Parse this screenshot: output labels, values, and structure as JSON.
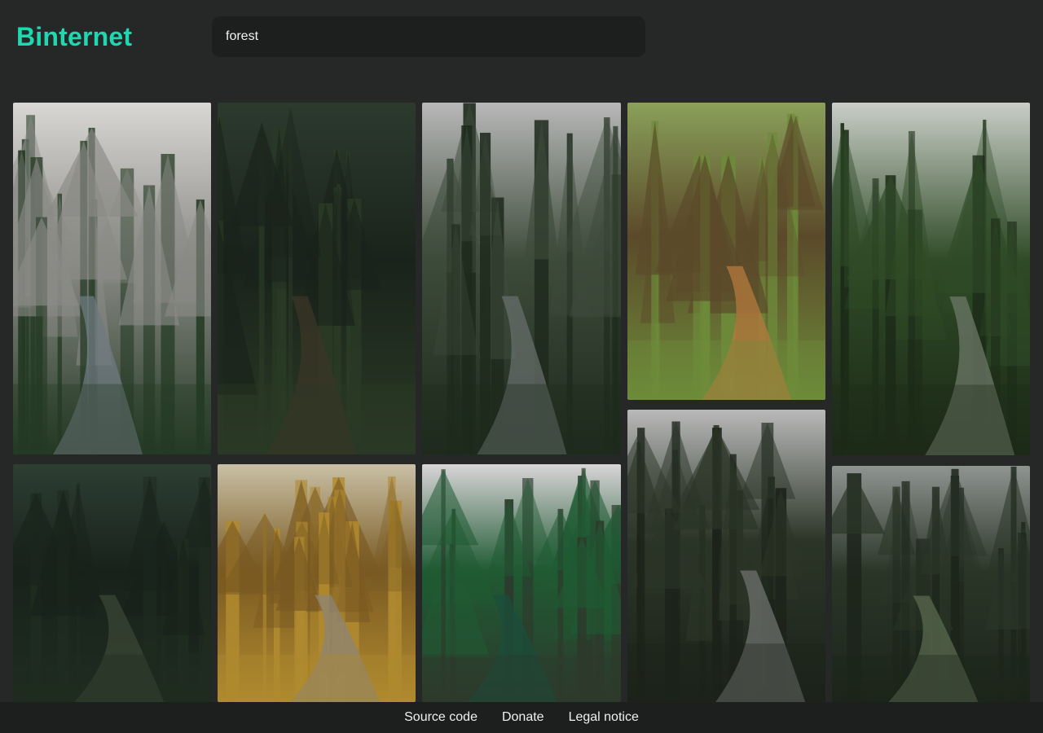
{
  "app": {
    "title": "Binternet",
    "accent": "#1fd8b1"
  },
  "search": {
    "value": "forest"
  },
  "results": [
    {
      "name": "image-mountain-river-forest",
      "palette": [
        "#d9d7d4",
        "#8a8a86",
        "#243a24",
        "#6f7a80"
      ]
    },
    {
      "name": "image-dark-misty-forest-path",
      "palette": [
        "#2c3a2e",
        "#1a231b",
        "#2a3a25",
        "#3b3527"
      ]
    },
    {
      "name": "image-forest-stream-cloudy",
      "palette": [
        "#b8b8b8",
        "#3d4b3a",
        "#1e2a1d",
        "#676d6b"
      ]
    },
    {
      "name": "image-sunlit-pine-trail",
      "palette": [
        "#8aa05a",
        "#5b4a2a",
        "#6d8b3a",
        "#b57a3e"
      ]
    },
    {
      "name": "image-mossy-arch-tree-creek",
      "palette": [
        "#c9cec7",
        "#2f4a26",
        "#1c2a18",
        "#6c7868"
      ]
    },
    {
      "name": "image-dark-conifer-forest",
      "palette": [
        "#2d3e33",
        "#18221b",
        "#1f2c20",
        "#3a4534"
      ]
    },
    {
      "name": "image-autumn-forest-creek",
      "palette": [
        "#c9c0a6",
        "#7a5a22",
        "#b08a2f",
        "#8d8475"
      ]
    },
    {
      "name": "image-emerald-river-canyon",
      "palette": [
        "#d9d5d8",
        "#1f5a33",
        "#2d3a2c",
        "#1b4d3b"
      ]
    },
    {
      "name": "image-cloudy-valley-stream",
      "palette": [
        "#b9b9b9",
        "#2b3527",
        "#1c231a",
        "#6e716d"
      ]
    },
    {
      "name": "image-foggy-fallen-tree-forest",
      "palette": [
        "#8f9491",
        "#2a3527",
        "#1d251b",
        "#5a6a4f"
      ]
    }
  ],
  "footer": {
    "links": [
      "Source code",
      "Donate",
      "Legal notice"
    ]
  }
}
